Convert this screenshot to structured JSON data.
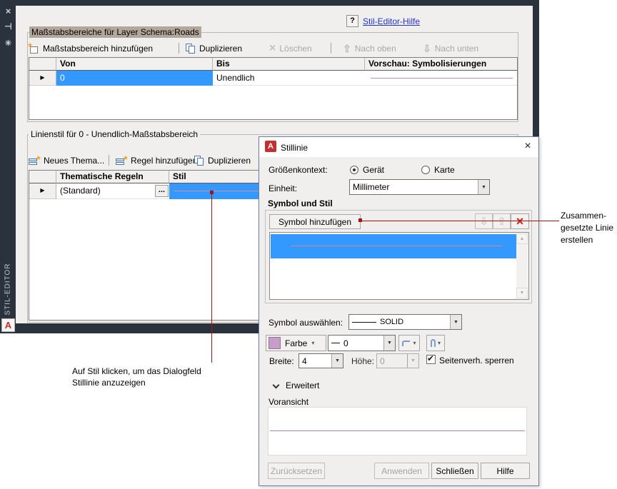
{
  "colors": {
    "selection_blue": "#3399ff",
    "preview_line_purple": "#b283b2",
    "pink_line": "#d4849b",
    "color_swatch": "#c79dc9",
    "annotation_red": "#aa1111",
    "link_blue": "#2233cc",
    "sidebar_dark": "#2a323e"
  },
  "icons": {
    "close_x": "×",
    "pin": "⊣",
    "gear": "✳",
    "help": "?",
    "logo": "A",
    "row_arrow": "▶",
    "dropdown": "▼",
    "dropdown_small": "▾",
    "up_hollow": "⇧",
    "down_hollow": "⇩",
    "delete_x": "×",
    "scroll_up": "▲",
    "scroll_down": "▼",
    "check": "✔",
    "star": "★",
    "ellipsis": "..."
  },
  "sidebar": {
    "title": "STIL-EDITOR"
  },
  "help": {
    "link": "Stil-Editor-Hilfe"
  },
  "scale_section": {
    "label": "Maßstabsbereiche für Layer Schema:Roads",
    "toolbar": {
      "add": "Maßstabsbereich hinzufügen",
      "duplicate": "Duplizieren",
      "delete": "Löschen",
      "up": "Nach oben",
      "down": "Nach unten"
    },
    "columns": [
      "Von",
      "Bis",
      "Vorschau: Symbolisierungen"
    ],
    "row": {
      "von": "0",
      "bis": "Unendlich"
    }
  },
  "line_section": {
    "label": "Linienstil für 0 - Unendlich-Maßstabsbereich",
    "toolbar": {
      "new_theme": "Neues Thema...",
      "add_rule": "Regel hinzufügen",
      "duplicate": "Duplizieren"
    },
    "columns": [
      "Thematische Regeln",
      "Stil"
    ],
    "row": {
      "rule": "(Standard)"
    }
  },
  "dialog": {
    "title": "Stillinie",
    "size_context": {
      "label": "Größenkontext:",
      "device": "Gerät",
      "map": "Karte"
    },
    "unit": {
      "label": "Einheit:",
      "value": "Millimeter"
    },
    "symbol_group": "Symbol und Stil",
    "add_symbol": "Symbol hinzufügen",
    "select_symbol": {
      "label": "Symbol auswählen:",
      "value": "SOLID"
    },
    "color_button": "Farbe",
    "weight_value": "0",
    "width": {
      "label": "Breite:",
      "value": "4"
    },
    "height": {
      "label": "Höhe:",
      "value": "0"
    },
    "lock_aspect": "Seitenverh. sperren",
    "advanced": "Erweitert",
    "preview": "Voransicht",
    "buttons": {
      "reset": "Zurücksetzen",
      "apply": "Anwenden",
      "close": "Schließen",
      "help": "Hilfe"
    }
  },
  "annotations": {
    "composite": [
      "Zusammen-",
      "gesetzte Linie",
      "erstellen"
    ],
    "click_style": [
      "Auf Stil klicken, um das Dialogfeld",
      "Stillinie anzuzeigen"
    ]
  }
}
